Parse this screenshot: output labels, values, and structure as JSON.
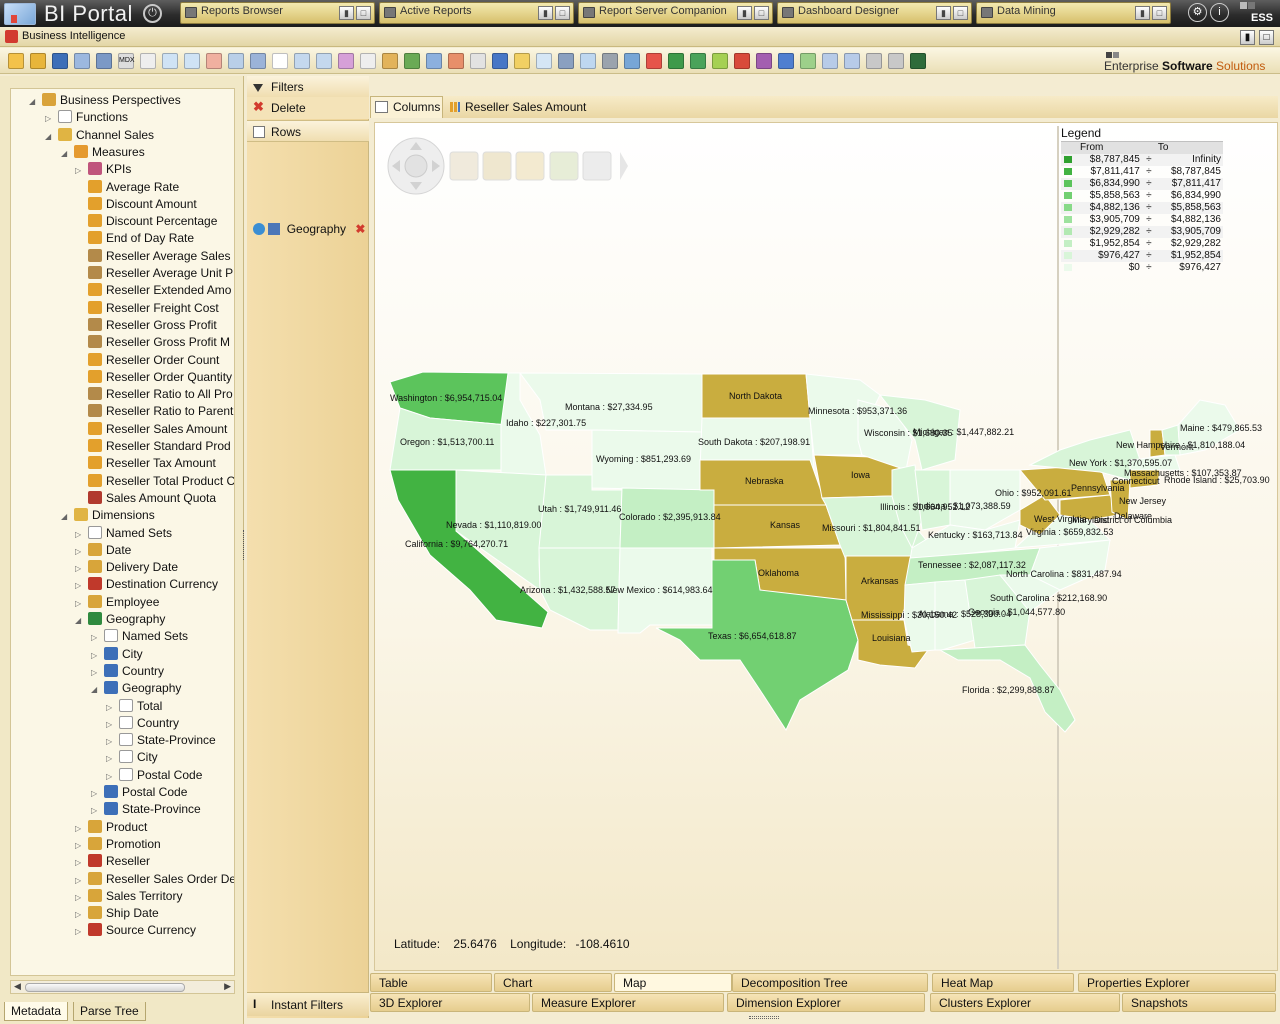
{
  "app": {
    "title": "BI Portal",
    "brand_short": "ESS"
  },
  "top_tabs": [
    {
      "label": "Reports Browser"
    },
    {
      "label": "Active Reports"
    },
    {
      "label": "Report Server Companion"
    },
    {
      "label": "Dashboard Designer"
    },
    {
      "label": "Data Mining"
    }
  ],
  "window": {
    "title": "Business Intelligence"
  },
  "brand": {
    "prefix": "Enterprise ",
    "bold": "Software",
    "suffix": " Solutions"
  },
  "tree": [
    {
      "label": "Business Perspectives",
      "depth": 0,
      "toggle": "◢",
      "icon": "cube-folder-icon"
    },
    {
      "label": "Functions",
      "depth": 1,
      "toggle": "▷",
      "icon": "function-icon"
    },
    {
      "label": "Channel Sales",
      "depth": 1,
      "toggle": "◢",
      "icon": "cube-icon"
    },
    {
      "label": "Measures",
      "depth": 2,
      "toggle": "◢",
      "icon": "measures-icon"
    },
    {
      "label": "KPIs",
      "depth": 3,
      "toggle": "▷",
      "icon": "kpi-icon"
    },
    {
      "label": "Average Rate",
      "depth": 3,
      "toggle": "",
      "icon": "measure-icon"
    },
    {
      "label": "Discount Amount",
      "depth": 3,
      "toggle": "",
      "icon": "measure-icon"
    },
    {
      "label": "Discount Percentage",
      "depth": 3,
      "toggle": "",
      "icon": "measure-icon"
    },
    {
      "label": "End of Day Rate",
      "depth": 3,
      "toggle": "",
      "icon": "measure-icon"
    },
    {
      "label": "Reseller Average Sales",
      "depth": 3,
      "toggle": "",
      "icon": "calculated-measure-icon"
    },
    {
      "label": "Reseller Average Unit P",
      "depth": 3,
      "toggle": "",
      "icon": "calculated-measure-icon"
    },
    {
      "label": "Reseller Extended Amo",
      "depth": 3,
      "toggle": "",
      "icon": "measure-icon"
    },
    {
      "label": "Reseller Freight Cost",
      "depth": 3,
      "toggle": "",
      "icon": "measure-icon"
    },
    {
      "label": "Reseller Gross Profit",
      "depth": 3,
      "toggle": "",
      "icon": "calculated-measure-icon"
    },
    {
      "label": "Reseller Gross Profit M",
      "depth": 3,
      "toggle": "",
      "icon": "calculated-measure-icon"
    },
    {
      "label": "Reseller Order Count",
      "depth": 3,
      "toggle": "",
      "icon": "measure-icon"
    },
    {
      "label": "Reseller Order Quantity",
      "depth": 3,
      "toggle": "",
      "icon": "measure-icon"
    },
    {
      "label": "Reseller Ratio to All Pro",
      "depth": 3,
      "toggle": "",
      "icon": "calculated-measure-icon"
    },
    {
      "label": "Reseller Ratio to Parent",
      "depth": 3,
      "toggle": "",
      "icon": "calculated-measure-icon"
    },
    {
      "label": "Reseller Sales Amount",
      "depth": 3,
      "toggle": "",
      "icon": "measure-icon"
    },
    {
      "label": "Reseller Standard Prod",
      "depth": 3,
      "toggle": "",
      "icon": "measure-icon"
    },
    {
      "label": "Reseller Tax Amount",
      "depth": 3,
      "toggle": "",
      "icon": "measure-icon"
    },
    {
      "label": "Reseller Total Product C",
      "depth": 3,
      "toggle": "",
      "icon": "measure-icon"
    },
    {
      "label": "Sales Amount Quota",
      "depth": 3,
      "toggle": "",
      "icon": "quota-icon"
    },
    {
      "label": "Dimensions",
      "depth": 2,
      "toggle": "◢",
      "icon": "dimensions-icon"
    },
    {
      "label": "Named Sets",
      "depth": 3,
      "toggle": "▷",
      "icon": "named-set-icon"
    },
    {
      "label": "Date",
      "depth": 3,
      "toggle": "▷",
      "icon": "date-dimension-icon"
    },
    {
      "label": "Delivery Date",
      "depth": 3,
      "toggle": "▷",
      "icon": "date-dimension-icon"
    },
    {
      "label": "Destination Currency",
      "depth": 3,
      "toggle": "▷",
      "icon": "currency-dimension-icon"
    },
    {
      "label": "Employee",
      "depth": 3,
      "toggle": "▷",
      "icon": "dimension-icon"
    },
    {
      "label": "Geography",
      "depth": 3,
      "toggle": "◢",
      "icon": "geography-dimension-icon"
    },
    {
      "label": "Named Sets",
      "depth": 4,
      "toggle": "▷",
      "icon": "named-set-icon"
    },
    {
      "label": "City",
      "depth": 4,
      "toggle": "▷",
      "icon": "attribute-icon"
    },
    {
      "label": "Country",
      "depth": 4,
      "toggle": "▷",
      "icon": "attribute-icon"
    },
    {
      "label": "Geography",
      "depth": 4,
      "toggle": "◢",
      "icon": "hierarchy-icon"
    },
    {
      "label": "Total",
      "depth": 5,
      "toggle": "▷",
      "icon": "level-1-icon"
    },
    {
      "label": "Country",
      "depth": 5,
      "toggle": "▷",
      "icon": "level-2-icon"
    },
    {
      "label": "State-Province",
      "depth": 5,
      "toggle": "▷",
      "icon": "level-3-icon"
    },
    {
      "label": "City",
      "depth": 5,
      "toggle": "▷",
      "icon": "level-4-icon"
    },
    {
      "label": "Postal Code",
      "depth": 5,
      "toggle": "▷",
      "icon": "level-5-icon"
    },
    {
      "label": "Postal Code",
      "depth": 4,
      "toggle": "▷",
      "icon": "attribute-icon"
    },
    {
      "label": "State-Province",
      "depth": 4,
      "toggle": "▷",
      "icon": "attribute-icon"
    },
    {
      "label": "Product",
      "depth": 3,
      "toggle": "▷",
      "icon": "dimension-icon"
    },
    {
      "label": "Promotion",
      "depth": 3,
      "toggle": "▷",
      "icon": "tv-dimension-icon"
    },
    {
      "label": "Reseller",
      "depth": 3,
      "toggle": "▷",
      "icon": "reseller-dimension-icon"
    },
    {
      "label": "Reseller Sales Order De",
      "depth": 3,
      "toggle": "▷",
      "icon": "dimension-icon"
    },
    {
      "label": "Sales Territory",
      "depth": 3,
      "toggle": "▷",
      "icon": "dimension-icon"
    },
    {
      "label": "Ship Date",
      "depth": 3,
      "toggle": "▷",
      "icon": "date-dimension-icon"
    },
    {
      "label": "Source Currency",
      "depth": 3,
      "toggle": "▷",
      "icon": "currency-dimension-icon"
    }
  ],
  "left_tabs": [
    {
      "label": "Metadata"
    },
    {
      "label": "Parse Tree"
    }
  ],
  "mid": {
    "filters": "Filters",
    "delete": "Delete",
    "rows": "Rows",
    "row_item": "Geography",
    "instant_filters": "Instant Filters"
  },
  "columns": {
    "caption": "Columns",
    "item": "Reseller Sales Amount"
  },
  "legend": {
    "title": "Legend",
    "header_from": "From",
    "header_to": "To",
    "rows": [
      {
        "from": "$8,787,845",
        "to": "Infinity",
        "color": "#2fa12f"
      },
      {
        "from": "$7,811,417",
        "to": "$8,787,845",
        "color": "#42b342"
      },
      {
        "from": "$6,834,990",
        "to": "$7,811,417",
        "color": "#5cc45c"
      },
      {
        "from": "$5,858,563",
        "to": "$6,834,990",
        "color": "#72d072"
      },
      {
        "from": "$4,882,136",
        "to": "$5,858,563",
        "color": "#88da88"
      },
      {
        "from": "$3,905,709",
        "to": "$4,882,136",
        "color": "#9ee29e"
      },
      {
        "from": "$2,929,282",
        "to": "$3,905,709",
        "color": "#b2e9b2"
      },
      {
        "from": "$1,952,854",
        "to": "$2,929,282",
        "color": "#c4efc4"
      },
      {
        "from": "$976,427",
        "to": "$1,952,854",
        "color": "#d8f5d8"
      },
      {
        "from": "$0",
        "to": "$976,427",
        "color": "#ebfaeb"
      }
    ]
  },
  "map": {
    "no_data_color": "#c9ad3f",
    "labels": [
      "Washington : $6,954,715.04",
      "Montana : $27,334.95",
      "North Dakota",
      "Minnesota : $953,371.36",
      "Idaho : $227,301.75",
      "Oregon : $1,513,700.11",
      "South Dakota : $207,198.91",
      "Wisconsin : $1,680.35",
      "Michigan : $1,447,882.21",
      "Maine : $479,865.53",
      "New Hampshire : $1,810,188.04",
      "Vermont",
      "New York : $1,370,595.07",
      "Massachusetts : $107,353.87",
      "Wyoming : $851,293.69",
      "Nebraska",
      "Iowa",
      "Connecticut",
      "Rhode Island : $25,703.90",
      "Pennsylvania",
      "Ohio : $952,091.61",
      "New Jersey",
      "Utah : $1,749,911.46",
      "Illinois : $1,664,952.12",
      "Indiana : $1,073,388.59",
      "West Virginia",
      "Delaware",
      "Maryland",
      "District of Columbia",
      "Nevada : $1,110,819.00",
      "Colorado : $2,395,913.84",
      "Kansas",
      "Missouri : $1,804,841.51",
      "Kentucky : $163,713.84",
      "Virginia : $659,832.53",
      "California : $9,764,270.71",
      "Tennessee : $2,087,117.32",
      "North Carolina : $831,487.94",
      "Oklahoma",
      "Arkansas",
      "Arizona : $1,432,588.57",
      "New Mexico : $614,983.64",
      "South Carolina : $212,168.90",
      "Mississippi : $30,150.42",
      "Alabama : $528,300.04",
      "Georgia : $1,044,577.80",
      "Texas : $6,654,618.87",
      "Louisiana",
      "Florida : $2,299,888.87"
    ],
    "latitude_label": "Latitude:",
    "latitude": "25.6476",
    "longitude_label": "Longitude:",
    "longitude": "-108.4610"
  },
  "bottom_tabs": [
    {
      "label": "Table"
    },
    {
      "label": "Chart"
    },
    {
      "label": "Map"
    },
    {
      "label": "Decomposition Tree"
    },
    {
      "label": "Heat Map"
    },
    {
      "label": "Properties Explorer"
    },
    {
      "label": "3D Explorer"
    },
    {
      "label": "Measure Explorer"
    },
    {
      "label": "Dimension Explorer"
    },
    {
      "label": "Clusters Explorer"
    },
    {
      "label": "Snapshots"
    }
  ]
}
